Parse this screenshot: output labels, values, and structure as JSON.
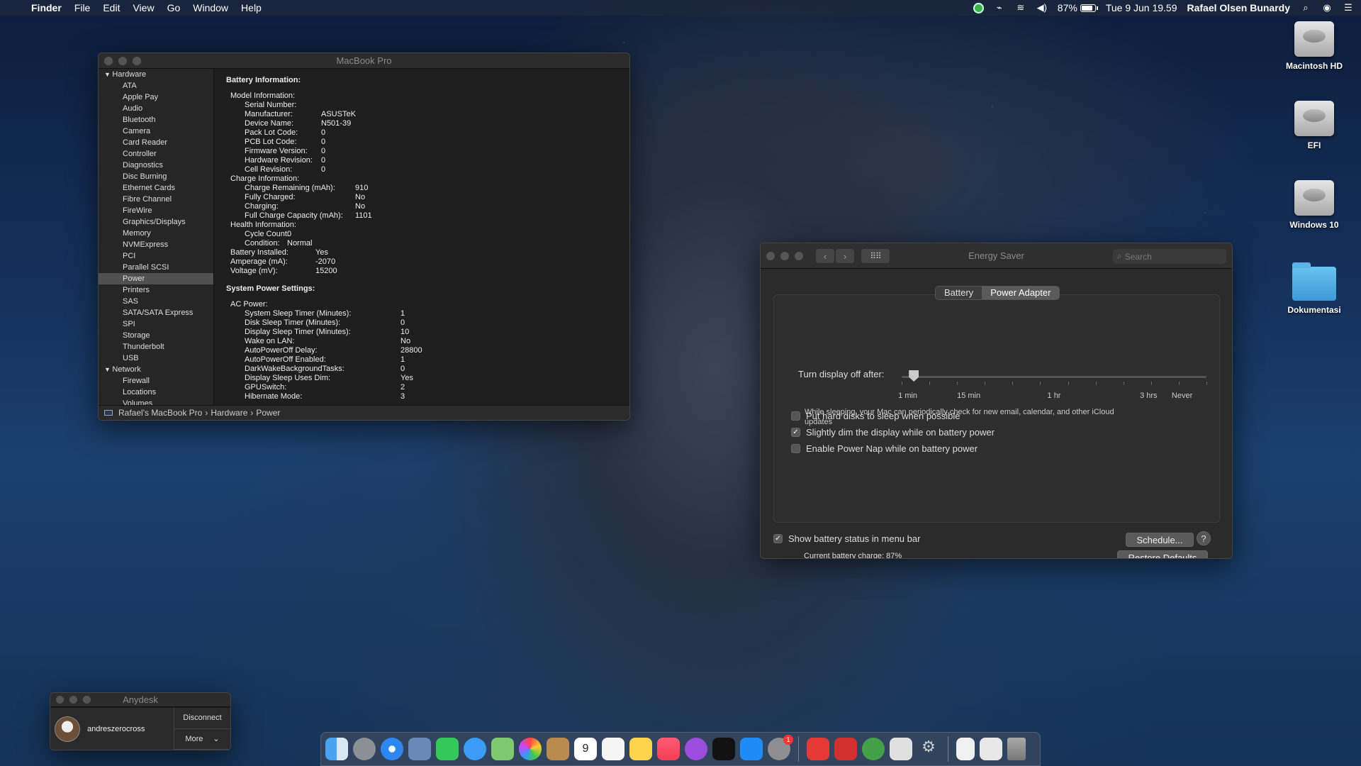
{
  "menubar": {
    "app": "Finder",
    "menus": [
      "File",
      "Edit",
      "View",
      "Go",
      "Window",
      "Help"
    ],
    "battery_percent": "87%",
    "datetime": "Tue 9 Jun  19.59",
    "user": "Rafael Olsen Bunardy"
  },
  "sysinfo": {
    "title": "MacBook Pro",
    "sidebar": {
      "hardware_label": "Hardware",
      "hardware_items": [
        "ATA",
        "Apple Pay",
        "Audio",
        "Bluetooth",
        "Camera",
        "Card Reader",
        "Controller",
        "Diagnostics",
        "Disc Burning",
        "Ethernet Cards",
        "Fibre Channel",
        "FireWire",
        "Graphics/Displays",
        "Memory",
        "NVMExpress",
        "PCI",
        "Parallel SCSI",
        "Power",
        "Printers",
        "SAS",
        "SATA/SATA Express",
        "SPI",
        "Storage",
        "Thunderbolt",
        "USB"
      ],
      "selected": "Power",
      "network_label": "Network",
      "network_items": [
        "Firewall",
        "Locations",
        "Volumes"
      ]
    },
    "detail": {
      "battery_heading": "Battery Information:",
      "model_heading": "Model Information:",
      "model": [
        {
          "k": "Serial Number:",
          "v": ""
        },
        {
          "k": "Manufacturer:",
          "v": "ASUSTeK"
        },
        {
          "k": "Device Name:",
          "v": "N501-39"
        },
        {
          "k": "Pack Lot Code:",
          "v": "0"
        },
        {
          "k": "PCB Lot Code:",
          "v": "0"
        },
        {
          "k": "Firmware Version:",
          "v": "0"
        },
        {
          "k": "Hardware Revision:",
          "v": "0"
        },
        {
          "k": "Cell Revision:",
          "v": "0"
        }
      ],
      "charge_heading": "Charge Information:",
      "charge": [
        {
          "k": "Charge Remaining (mAh):",
          "v": "910"
        },
        {
          "k": "Fully Charged:",
          "v": "No"
        },
        {
          "k": "Charging:",
          "v": "No"
        },
        {
          "k": "Full Charge Capacity (mAh):",
          "v": "1101"
        }
      ],
      "health_heading": "Health Information:",
      "health": [
        {
          "k": "Cycle Count:",
          "v": "0"
        },
        {
          "k": "Condition:",
          "v": "Normal"
        }
      ],
      "battery_misc": [
        {
          "k": "Battery Installed:",
          "v": "Yes"
        },
        {
          "k": "Amperage (mA):",
          "v": "-2070"
        },
        {
          "k": "Voltage (mV):",
          "v": "15200"
        }
      ],
      "system_heading": "System Power Settings:",
      "ac_heading": "AC Power:",
      "ac": [
        {
          "k": "System Sleep Timer (Minutes):",
          "v": "1"
        },
        {
          "k": "Disk Sleep Timer (Minutes):",
          "v": "0"
        },
        {
          "k": "Display Sleep Timer (Minutes):",
          "v": "10"
        },
        {
          "k": "Wake on LAN:",
          "v": "No"
        },
        {
          "k": "AutoPowerOff Delay:",
          "v": "28800"
        },
        {
          "k": "AutoPowerOff Enabled:",
          "v": "1"
        },
        {
          "k": "DarkWakeBackgroundTasks:",
          "v": "0"
        },
        {
          "k": "Display Sleep Uses Dim:",
          "v": "Yes"
        },
        {
          "k": "GPUSwitch:",
          "v": "2"
        },
        {
          "k": "Hibernate Mode:",
          "v": "3"
        }
      ]
    },
    "path": [
      "Rafael's MacBook Pro",
      "Hardware",
      "Power"
    ]
  },
  "energy": {
    "title": "Energy Saver",
    "search_placeholder": "Search",
    "tabs": [
      "Battery",
      "Power Adapter"
    ],
    "active_tab": "Power Adapter",
    "slider_label": "Turn display off after:",
    "slider_value_fraction": 0.04,
    "tick_labels": [
      "1 min",
      "15 min",
      "1 hr",
      "3 hrs",
      "Never"
    ],
    "options": [
      {
        "label": "Put hard disks to sleep when possible",
        "checked": false
      },
      {
        "label": "Slightly dim the display while on battery power",
        "checked": true
      },
      {
        "label": "Enable Power Nap while on battery power",
        "checked": false
      }
    ],
    "power_nap_note": "While sleeping, your Mac can periodically check for new email, calendar, and other iCloud updates",
    "charge_text": "Current battery charge: 87%",
    "restore_label": "Restore Defaults",
    "show_status_label": "Show battery status in menu bar",
    "show_status_checked": true,
    "schedule_label": "Schedule...",
    "help_label": "?"
  },
  "desktop_icons": [
    "Macintosh HD",
    "EFI",
    "Windows 10",
    "Dokumentasi"
  ],
  "anydesk": {
    "title": "Anydesk",
    "user": "andreszerocross",
    "disconnect": "Disconnect",
    "more": "More"
  },
  "dock": {
    "calendar_day": "9",
    "badge": "1"
  }
}
